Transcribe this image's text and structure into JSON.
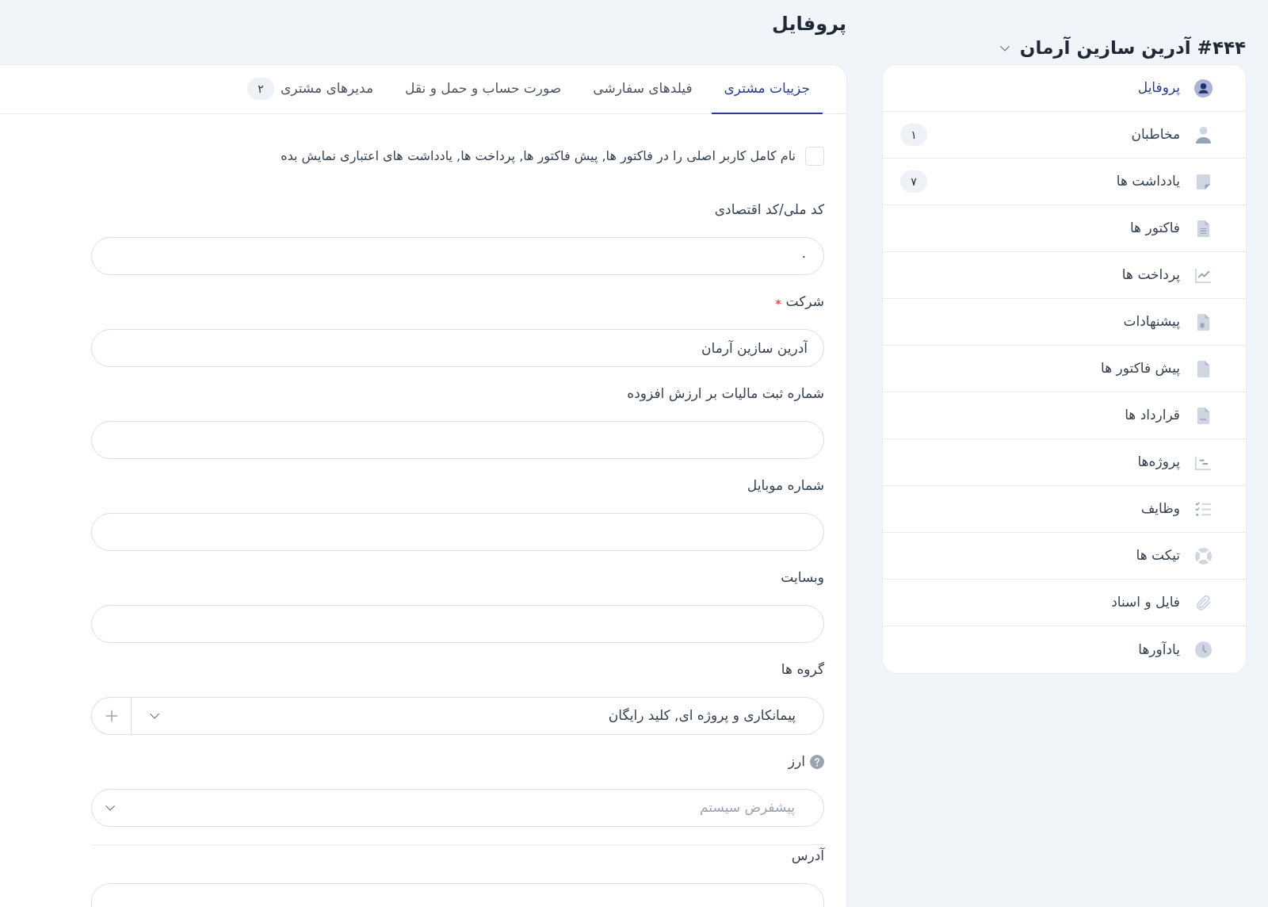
{
  "header": {
    "title": "پروفایل"
  },
  "customer_switcher": {
    "label": "#۴۴۴ آدرین سازین آرمان"
  },
  "sidebar": {
    "items": [
      {
        "label": "پروفایل",
        "selected": true
      },
      {
        "label": "مخاطبان",
        "selected": false,
        "badge": "۱"
      },
      {
        "label": "یادداشت ها",
        "selected": false,
        "badge": "۷"
      },
      {
        "label": "فاکتور ها",
        "selected": false
      },
      {
        "label": "پرداخت ها",
        "selected": false
      },
      {
        "label": "پیشنهادات",
        "selected": false
      },
      {
        "label": "پیش فاکتور ها",
        "selected": false
      },
      {
        "label": "قرارداد ها",
        "selected": false
      },
      {
        "label": "پروژه‌ها",
        "selected": false
      },
      {
        "label": "وظایف",
        "selected": false
      },
      {
        "label": "تیکت ها",
        "selected": false
      },
      {
        "label": "فایل و اسناد",
        "selected": false
      },
      {
        "label": "یادآورها",
        "selected": false
      }
    ]
  },
  "tabs": [
    {
      "label": "جزییات مشتری",
      "selected": true
    },
    {
      "label": "فیلدهای سفارشی",
      "selected": false
    },
    {
      "label": "صورت حساب و حمل و نقل",
      "selected": false
    },
    {
      "label": "مدیرهای مشتری",
      "selected": false,
      "badge": "۲"
    }
  ],
  "form": {
    "fields": [
      {
        "kind": "checkbox",
        "label": "نام کامل کاربر اصلی را در فاکتور ها, پیش فاکتور ها, پرداخت ها, یادداشت های اعتباری نمایش بده",
        "checked": false
      },
      {
        "kind": "text",
        "label": "کد ملی/کد اقتصادی",
        "value": "۰",
        "required": false,
        "help": false
      },
      {
        "kind": "text",
        "label": "شرکت",
        "value": "آدرین سازین آرمان",
        "required": true,
        "help": false
      },
      {
        "kind": "text",
        "label": "شماره ثبت مالیات بر ارزش افزوده",
        "required": false,
        "help": false
      },
      {
        "kind": "text",
        "label": "شماره موبایل",
        "required": false,
        "help": false
      },
      {
        "kind": "text",
        "label": "وبسایت",
        "required": false,
        "help": false
      },
      {
        "kind": "multiselect",
        "label": "گروه ها",
        "value": "پیمانکاری و پروژه ای, کلید رایگان",
        "required": false,
        "help": false
      },
      {
        "kind": "select",
        "label": "ارز",
        "placeholder": "پیشفرض سیستم",
        "required": false,
        "help": true
      },
      {
        "kind": "textarea",
        "label": "آدرس",
        "required": false,
        "help": false
      }
    ]
  }
}
